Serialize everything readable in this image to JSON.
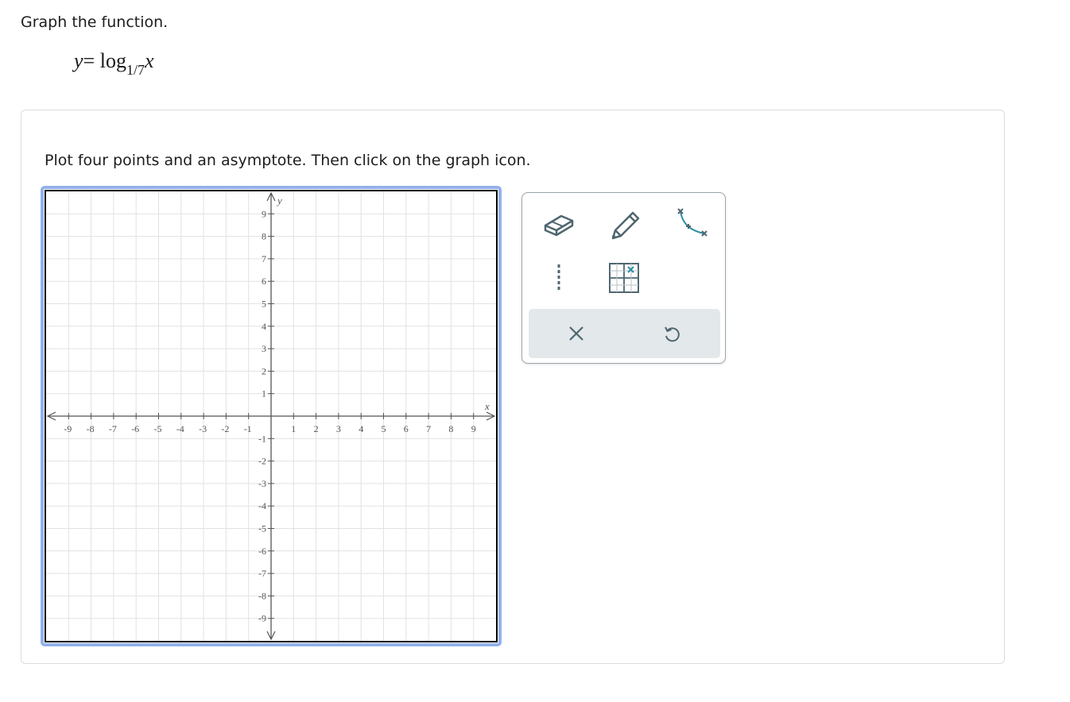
{
  "prompt": "Graph the function.",
  "equation": {
    "lhs": "y",
    "equals": "=",
    "func": "log",
    "base": "1/7",
    "arg": "x"
  },
  "instructions": "Plot four points and an asymptote. Then click on the graph icon.",
  "graph": {
    "x_min": -10,
    "x_max": 10,
    "y_min": -10,
    "y_max": 10,
    "x_axis_label": "x",
    "y_axis_label": "y",
    "tick_labels": [
      -9,
      -8,
      -7,
      -6,
      -5,
      -4,
      -3,
      -2,
      -1,
      1,
      2,
      3,
      4,
      5,
      6,
      7,
      8,
      9
    ],
    "grid_color": "#e2e2e2",
    "axis_color": "#555555",
    "frame_border_color": "#94b1ec"
  },
  "toolbar": {
    "tools": [
      {
        "name": "eraser-tool",
        "icon": "eraser-icon"
      },
      {
        "name": "pencil-tool",
        "icon": "pencil-icon"
      },
      {
        "name": "exponential-curve-tool",
        "icon": "curve-icon"
      },
      {
        "name": "asymptote-tool",
        "icon": "dashed-line-icon"
      },
      {
        "name": "graph-submit-tool",
        "icon": "graph-icon"
      }
    ],
    "actions": [
      {
        "name": "clear-button",
        "icon": "close-icon"
      },
      {
        "name": "undo-button",
        "icon": "undo-icon"
      }
    ],
    "icon_color": "#4f6670",
    "accent_color": "#2c8ea3"
  }
}
